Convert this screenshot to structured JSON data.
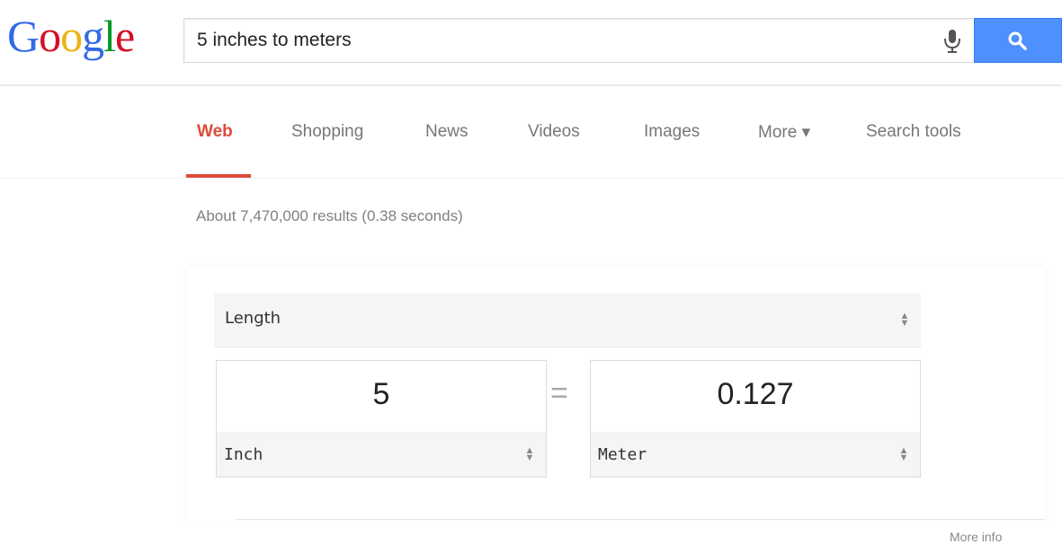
{
  "logo": {
    "letters": [
      "G",
      "o",
      "o",
      "g",
      "l",
      "e"
    ],
    "colors": [
      "#3369e8",
      "#d50f25",
      "#eeb211",
      "#3369e8",
      "#009925",
      "#d50f25"
    ]
  },
  "search": {
    "query": "5 inches to meters",
    "button_color": "#4d90fe"
  },
  "icons": {
    "mic": "microphone-icon",
    "search": "magnifier-icon",
    "updown": "up-down-arrows-icon"
  },
  "tabs": [
    {
      "label": "Web",
      "active": true
    },
    {
      "label": "Shopping",
      "active": false
    },
    {
      "label": "News",
      "active": false
    },
    {
      "label": "Videos",
      "active": false
    },
    {
      "label": "Images",
      "active": false
    },
    {
      "label": "More ▾",
      "active": false
    },
    {
      "label": "Search tools",
      "active": false
    }
  ],
  "accent_color": "#dd4b39",
  "results": {
    "stats": "About 7,470,000 results (0.38 seconds)"
  },
  "converter": {
    "quantity": "Length",
    "from": {
      "value": "5",
      "unit": "Inch"
    },
    "equals": "=",
    "to": {
      "value": "0.127",
      "unit": "Meter"
    }
  },
  "footer": {
    "more_info": "More info"
  }
}
